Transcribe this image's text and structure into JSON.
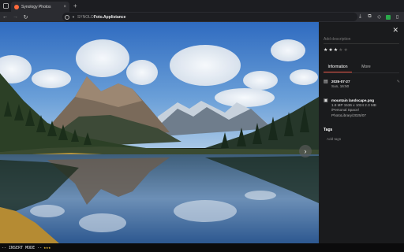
{
  "browser": {
    "tab_title": "Synology Photos",
    "url_prefix": "SYNOLO",
    "url_path": "Foto.Applistance",
    "new_tab": "+"
  },
  "photo": {
    "alt": "mountain landscape photo with lake reflection"
  },
  "panel": {
    "description_placeholder": "Add description",
    "rating": 3,
    "rating_max": 5,
    "tabs": [
      "Information",
      "More"
    ],
    "active_tab": 0,
    "date": "2025-07-27",
    "time": "Sun, 16:50",
    "filename": "mountain landscape.png",
    "specs": "1.8 MP   1536 x 1024  2.3 MB",
    "path_line1": "/Personal Space/",
    "path_line2": "PhotoLibrary/2025/07",
    "tags_heading": "Tags",
    "tags_placeholder": "Add tags"
  },
  "status": {
    "mode": "-- INSERT MODE -- ",
    "stars": "★★★"
  },
  "colors": {
    "accent": "#e14a3a",
    "brand": "#ff6a3c"
  }
}
